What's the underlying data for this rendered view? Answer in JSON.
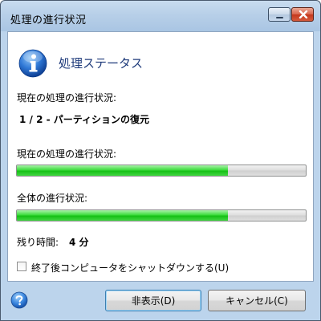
{
  "window": {
    "title": "処理の進行状況"
  },
  "header": {
    "icon": "info-icon",
    "title": "処理ステータス"
  },
  "current_task": {
    "label": "現在の処理の進行状況:",
    "value": "1 / 2 - パーティションの復元"
  },
  "current_progress": {
    "label": "現在の処理の進行状況:",
    "percent": 73
  },
  "overall_progress": {
    "label": "全体の進行状況:",
    "percent": 73
  },
  "time_left": {
    "label": "残り時間:",
    "value": "4 分"
  },
  "shutdown_option": {
    "label": "終了後コンピュータをシャットダウンする(U)",
    "checked": false
  },
  "buttons": {
    "hide": "非表示(D)",
    "cancel": "キャンセル(C)"
  },
  "colors": {
    "progress_fill": "#16c016",
    "title_accent": "#1e3a7a",
    "close_button": "#c4371c"
  }
}
